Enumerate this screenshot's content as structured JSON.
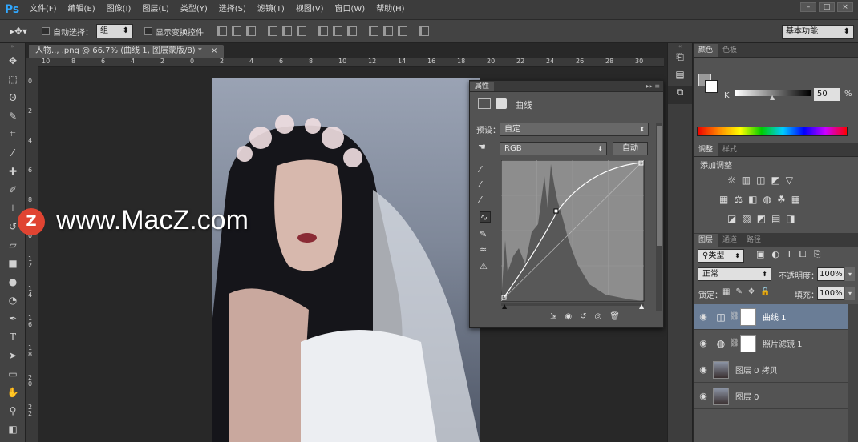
{
  "app": {
    "logo": "Ps"
  },
  "menu": [
    "文件(F)",
    "编辑(E)",
    "图像(I)",
    "图层(L)",
    "类型(Y)",
    "选择(S)",
    "滤镜(T)",
    "视图(V)",
    "窗口(W)",
    "帮助(H)"
  ],
  "options_bar": {
    "auto_select_label": "自动选择：",
    "auto_select_value": "组",
    "show_transform_label": "显示变换控件",
    "workspace": "基本功能"
  },
  "document": {
    "tab_title": "人物.., .png @ 66.7% (曲线 1, 图层蒙版/8) *",
    "ruler_h": [
      "10",
      "8",
      "6",
      "4",
      "2",
      "0",
      "2",
      "4",
      "6",
      "8",
      "10",
      "12",
      "14",
      "16",
      "18",
      "20",
      "22",
      "24",
      "26",
      "28",
      "30"
    ],
    "ruler_v": [
      "0",
      "2",
      "4",
      "6",
      "8",
      "1 0",
      "1 2",
      "1 4",
      "1 6",
      "1 8",
      "2 0",
      "2 2"
    ]
  },
  "watermark": {
    "text": "www.MacZ.com",
    "badge": "Z"
  },
  "properties": {
    "tab": "属性",
    "title": "曲线",
    "preset_label": "预设：",
    "preset_value": "自定",
    "channel_value": "RGB",
    "auto_button": "自动"
  },
  "color_panel": {
    "tabs": [
      "颜色",
      "色板"
    ],
    "channel": "K",
    "value": "50",
    "unit": "%",
    "value_pct": 50
  },
  "adjustments_panel": {
    "tabs": [
      "调整",
      "样式"
    ],
    "title": "添加调整"
  },
  "layers_panel": {
    "tabs": [
      "图层",
      "通道",
      "路径"
    ],
    "filter": "类型",
    "blend_mode": "正常",
    "opacity_label": "不透明度：",
    "opacity_value": "100%",
    "lock_label": "锁定：",
    "fill_label": "填充：",
    "fill_value": "100%",
    "layers": [
      {
        "name": "曲线 1",
        "selected": true
      },
      {
        "name": "照片滤镜 1",
        "selected": false
      },
      {
        "name": "图层 0 拷贝",
        "selected": false
      },
      {
        "name": "图层 0",
        "selected": false
      }
    ]
  },
  "colors": {
    "accent": "#31a8ff",
    "selected_layer": "#6a7d96"
  }
}
